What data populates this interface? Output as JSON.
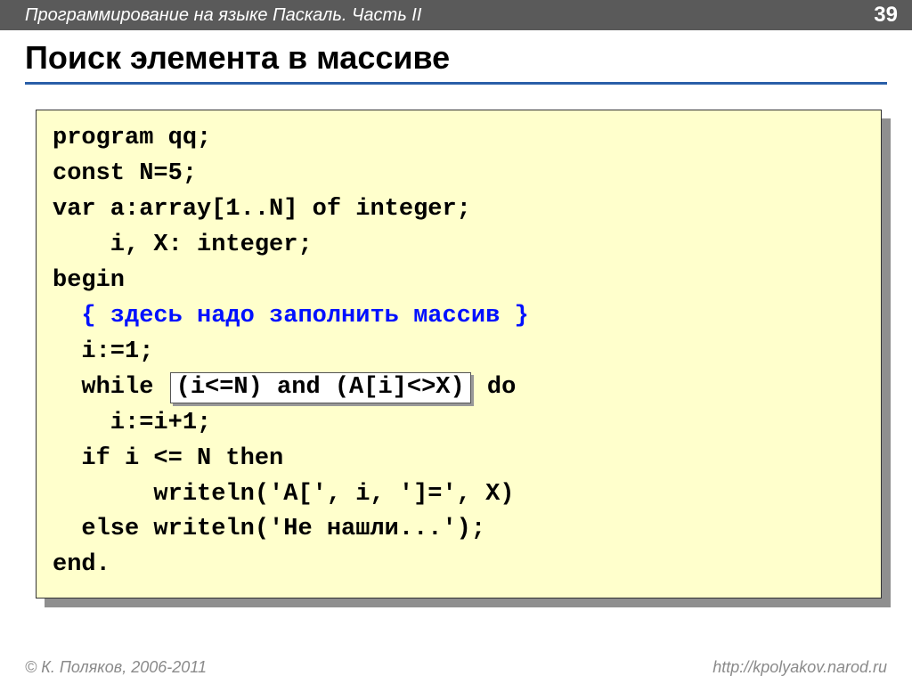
{
  "header": {
    "title": "Программирование на языке Паскаль. Часть II",
    "page": "39"
  },
  "title": "Поиск элемента в массиве",
  "code": {
    "l1": "program qq;",
    "l2": "const N=5;",
    "l3": "var a:array[1..N] of integer;",
    "l4": "    i, X: integer;",
    "l5": "begin",
    "l6": "{ здесь надо заполнить массив }",
    "l7": "  i:=1;",
    "l8a": "  while ",
    "l8h": "(i<=N) and (A[i]<>X)",
    "l8b": " do",
    "l9": "    i:=i+1;",
    "l10": "  if i <= N then",
    "l11": "       writeln('A[', i, ']=', X)",
    "l12": "  else writeln('Не нашли...');",
    "l13": "end."
  },
  "footer": {
    "left": "© К. Поляков, 2006-2011",
    "right": "http://kpolyakov.narod.ru"
  }
}
